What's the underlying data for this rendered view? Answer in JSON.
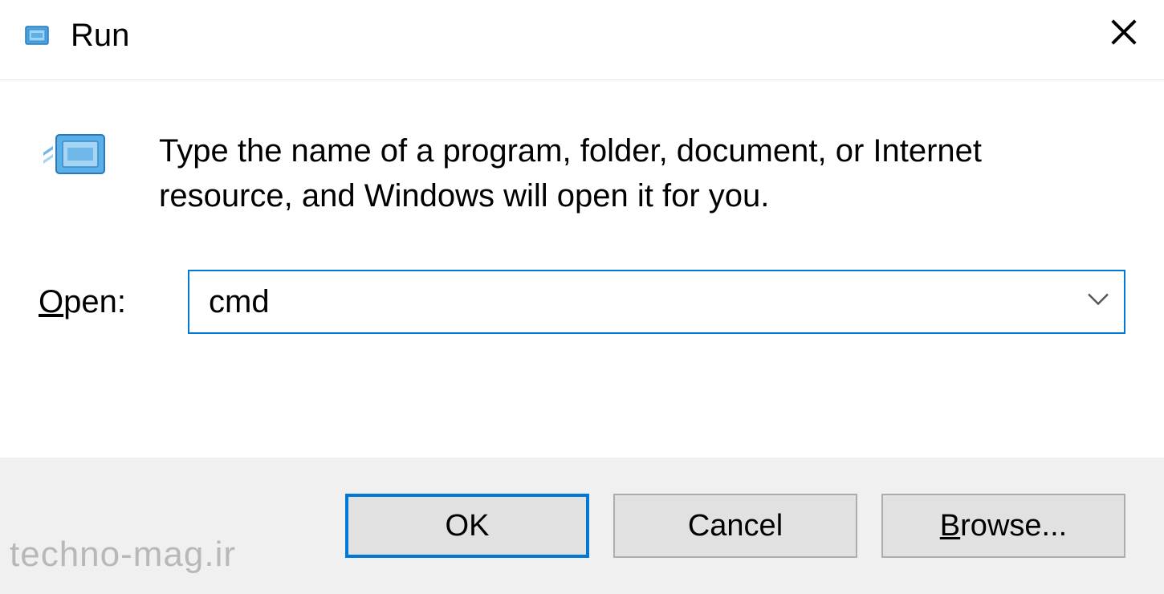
{
  "titlebar": {
    "title": "Run"
  },
  "body": {
    "description": "Type the name of a program, folder, document, or Internet resource, and Windows will open it for you.",
    "open_label_prefix": "O",
    "open_label_suffix": "pen:",
    "input_value": "cmd"
  },
  "buttons": {
    "ok": "OK",
    "cancel": "Cancel",
    "browse_prefix": "B",
    "browse_suffix": "rowse..."
  },
  "watermark": "techno-mag.ir"
}
